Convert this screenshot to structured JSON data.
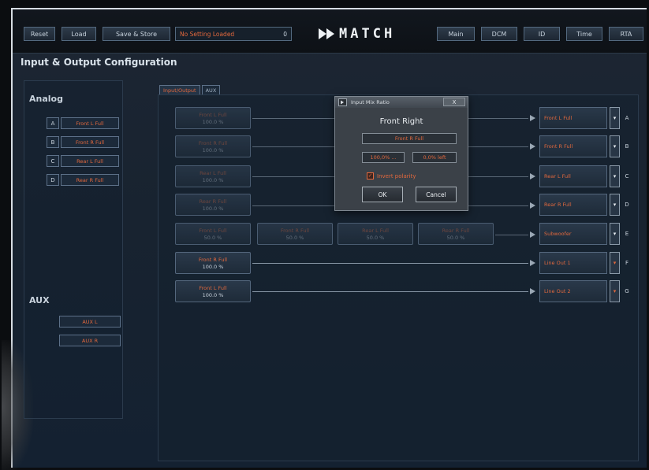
{
  "toolbar": {
    "reset": "Reset",
    "load": "Load",
    "save_store": "Save & Store",
    "status": "No Setting Loaded",
    "status_num": "0",
    "logo": "MATCH",
    "main": "Main",
    "dcm": "DCM",
    "id": "ID",
    "time": "Time",
    "rta": "RTA"
  },
  "page_title": "Input & Output Configuration",
  "analog": {
    "heading": "Analog",
    "inputs": [
      {
        "letter": "A",
        "name": "Front L Full"
      },
      {
        "letter": "B",
        "name": "Front R Full"
      },
      {
        "letter": "C",
        "name": "Rear L Full"
      },
      {
        "letter": "D",
        "name": "Rear R Full"
      }
    ]
  },
  "aux": {
    "heading": "AUX",
    "inputs": [
      "AUX L",
      "AUX R"
    ]
  },
  "tabs": [
    "Input/Output",
    "AUX"
  ],
  "matrix": {
    "rows": [
      {
        "sources": [
          {
            "name": "Front L Full",
            "value": "100.0 %"
          }
        ]
      },
      {
        "sources": [
          {
            "name": "Front R Full",
            "value": "100.0 %"
          }
        ]
      },
      {
        "sources": [
          {
            "name": "Rear L Full",
            "value": "100.0 %"
          }
        ]
      },
      {
        "sources": [
          {
            "name": "Rear R Full",
            "value": "100.0 %"
          }
        ]
      },
      {
        "sources": [
          {
            "name": "Front L Full",
            "value": "50.0 %"
          },
          {
            "name": "Front R Full",
            "value": "50.0 %"
          },
          {
            "name": "Rear L Full",
            "value": "50.0 %"
          },
          {
            "name": "Rear R Full",
            "value": "50.0 %"
          }
        ]
      },
      {
        "sources": [
          {
            "name": "Front R Full",
            "value": "100.0 %"
          }
        ]
      },
      {
        "sources": [
          {
            "name": "Front L Full",
            "value": "100.0 %"
          }
        ]
      }
    ],
    "outputs": [
      {
        "name": "Front L Full",
        "letter": "A",
        "selector": "▾"
      },
      {
        "name": "Front R Full",
        "letter": "B",
        "selector": "▾"
      },
      {
        "name": "Rear L Full",
        "letter": "C",
        "selector": "▾"
      },
      {
        "name": "Rear R Full",
        "letter": "D",
        "selector": "▾"
      },
      {
        "name": "Subwoofer",
        "letter": "E",
        "selector": "▾"
      },
      {
        "name": "Line Out 1",
        "letter": "F",
        "selector": "▾"
      },
      {
        "name": "Line Out 2",
        "letter": "G",
        "selector": "▾"
      }
    ]
  },
  "dialog": {
    "title": "Input Mix Ratio",
    "close": "X",
    "heading": "Front Right",
    "source": "Front R Full",
    "ratio": "100,0% ...",
    "balance": "0,0% left",
    "invert_label": "Invert polarity",
    "invert_mark": "✓",
    "ok": "OK",
    "cancel": "Cancel"
  }
}
